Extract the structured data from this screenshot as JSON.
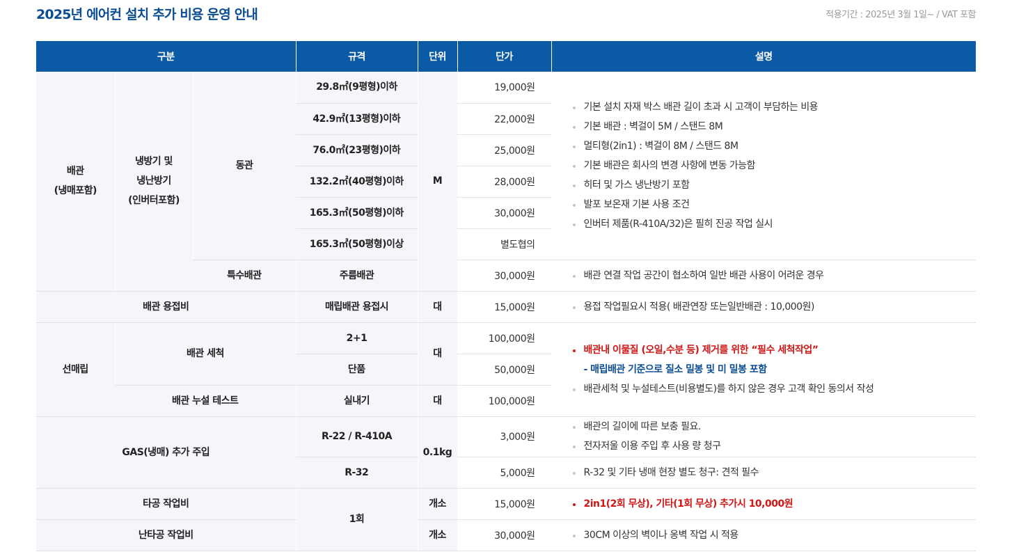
{
  "header": {
    "title": "2025년 에어컨 설치 추가 비용 운영 안내",
    "period": "적용기간 : 2025년 3월 1일~ / VAT 포함"
  },
  "columns": {
    "category": "구분",
    "spec": "규격",
    "unit": "단위",
    "price": "단가",
    "desc": "설명"
  },
  "piping": {
    "cat1": "배관\n(냉매포함)",
    "cat2": "냉방기 및\n냉난방기\n(인버터포함)",
    "cat3": "동관",
    "special": "특수배관",
    "unit": "M",
    "rows": [
      {
        "spec": "29.8㎡(9평형)이하",
        "price": "19,000원"
      },
      {
        "spec": "42.9㎡(13평형)이하",
        "price": "22,000원"
      },
      {
        "spec": "76.0㎡(23평형)이하",
        "price": "25,000원"
      },
      {
        "spec": "132.2㎡(40평형)이하",
        "price": "28,000원"
      },
      {
        "spec": "165.3㎡(50평형)이하",
        "price": "30,000원"
      },
      {
        "spec": "165.3㎡(50평형)이상",
        "price": "별도협의"
      }
    ],
    "special_row": {
      "spec": "주름배관",
      "price": "30,000원",
      "desc": "배관 연결 작업 공간이 협소하여 일반 배관 사용이 어려운 경우"
    },
    "desc": [
      "기본 설치 자재 박스 배관 길이 초과 시 고객이 부담하는 비용",
      "기본 배관 : 벽걸이 5M / 스탠드 8M",
      "멀티형(2in1) : 벽걸이 8M / 스탠드 8M",
      "기본 배관은 회사의 변경 사항에 변동 가능함",
      "히터 및 가스 냉난방기 포함",
      "발포 보온재 기본 사용 조건",
      "인버터 제품(R-410A/32)은 필히 진공 작업 실시"
    ]
  },
  "welding": {
    "cat": "배관 용접비",
    "spec": "매립배관 용접시",
    "unit": "대",
    "price": "15,000원",
    "desc": "용접 작업필요시 적용( 배관연장 또는일반배관 : 10,000원)"
  },
  "embedded": {
    "cat": "선매립",
    "cleaning": "배관 세척",
    "rows": [
      {
        "spec": "2+1",
        "price": "100,000원"
      },
      {
        "spec": "단품",
        "price": "50,000원"
      }
    ],
    "unit": "대",
    "leak": {
      "cat": "배관 누설 테스트",
      "spec": "실내기",
      "unit": "대",
      "price": "100,000원"
    },
    "desc_red": "배관내 이물질 (오일,수분 등) 제거를 위한 “필수 세척작업”",
    "desc_blue": "- 매립배관 기준으로 질소 밀봉 및 미 밀봉 포함",
    "desc": "배관세척 및 누설테스트(비용별도)를 하지 않은 경우 고객 확인 동의서 작성"
  },
  "gas": {
    "cat": "GAS(냉매) 추가 주입",
    "unit": "0.1kg",
    "rows": [
      {
        "spec": "R-22 / R-410A",
        "price": "3,000원"
      },
      {
        "spec": "R-32",
        "price": "5,000원"
      }
    ],
    "desc1": [
      "배관의 길이에 따른 보충 필요.",
      "전자저울 이용 주입 후 사용 량 청구"
    ],
    "desc2": "R-32 및 기타 냉매 현장 별도 청구: 견적 필수"
  },
  "drilling": {
    "spec": "1회",
    "unit": "개소",
    "rows": [
      {
        "cat": "타공 작업비",
        "price": "15,000원",
        "desc": "2in1(2회 무상), 기타(1회 무상) 추가시 10,000원"
      },
      {
        "cat": "난타공 작업비",
        "price": "30,000원",
        "desc": "30CM 이상의 벽이나 옹벽 작업 시 적용"
      }
    ]
  }
}
